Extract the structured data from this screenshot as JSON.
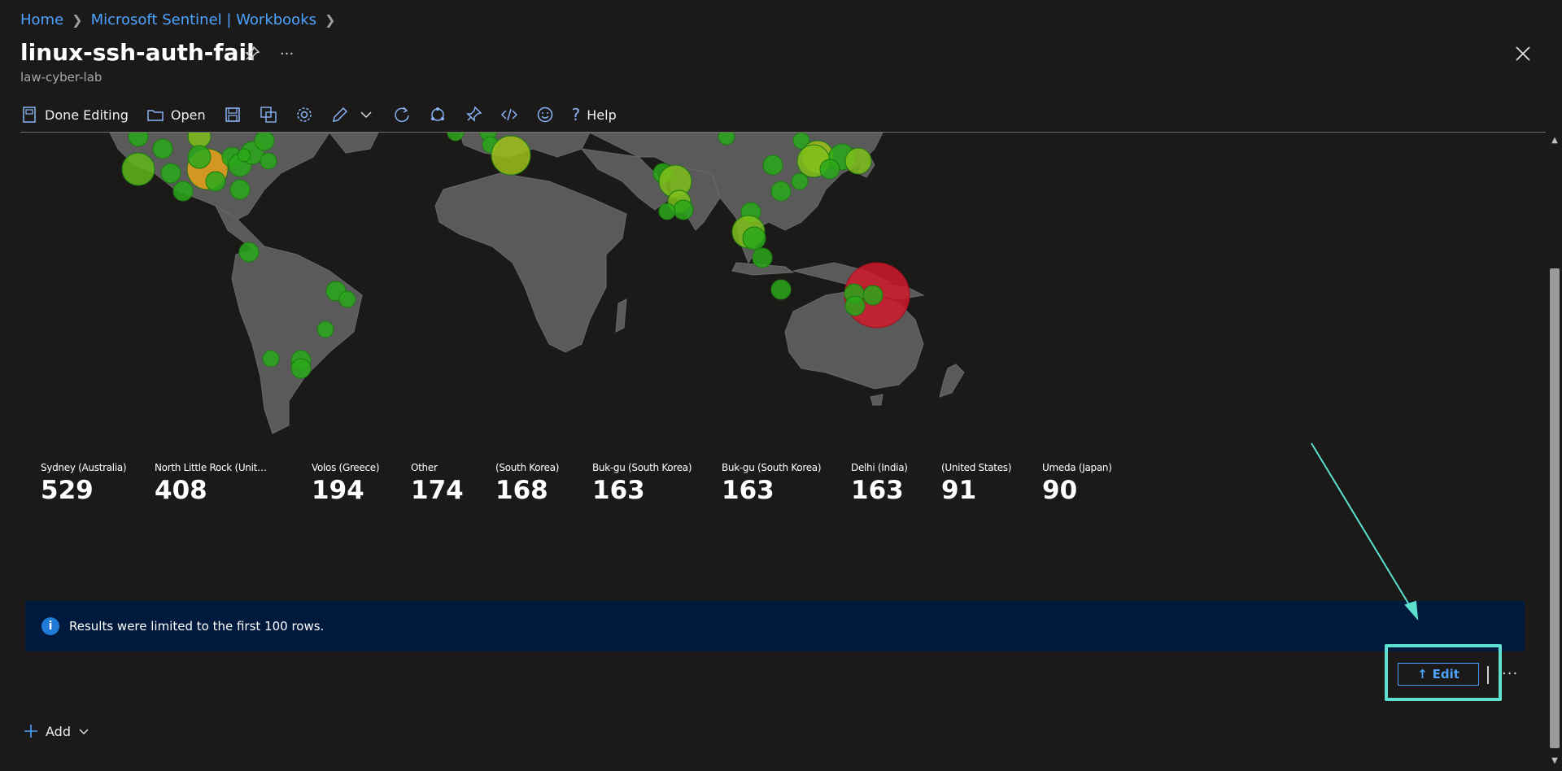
{
  "breadcrumb": {
    "items": [
      {
        "label": "Home"
      },
      {
        "label": "Microsoft Sentinel | Workbooks"
      }
    ]
  },
  "header": {
    "title": "linux-ssh-auth-fail",
    "subtitle": "law-cyber-lab",
    "more_label": "···"
  },
  "toolbar": {
    "done_editing": "Done Editing",
    "open": "Open",
    "help": "Help"
  },
  "tiles": [
    {
      "label": "Sydney (Australia)",
      "value": "529"
    },
    {
      "label": "North Little Rock (United ...",
      "value": "408"
    },
    {
      "label": "Volos (Greece)",
      "value": "194"
    },
    {
      "label": "Other",
      "value": "174"
    },
    {
      "label": "(South Korea)",
      "value": "168"
    },
    {
      "label": "Buk-gu (South Korea)",
      "value": "163"
    },
    {
      "label": "Buk-gu (South Korea)",
      "value": "163"
    },
    {
      "label": "Delhi (India)",
      "value": "163"
    },
    {
      "label": "(United States)",
      "value": "91"
    },
    {
      "label": "Umeda (Japan)",
      "value": "90"
    }
  ],
  "info_bar": {
    "message": "Results were limited to the first 100 rows."
  },
  "actions": {
    "edit_label": "Edit",
    "more_label": "···",
    "add_label": "Add"
  },
  "colors": {
    "accent": "#4da3ff",
    "info_bg": "#001a3d",
    "highlight": "#5de0cf",
    "land": "#5a5a5a",
    "marker_green": "#2aa81a",
    "marker_lime": "#9fbf1a",
    "marker_orange": "#e8a21a",
    "marker_red": "#d01a2a"
  }
}
